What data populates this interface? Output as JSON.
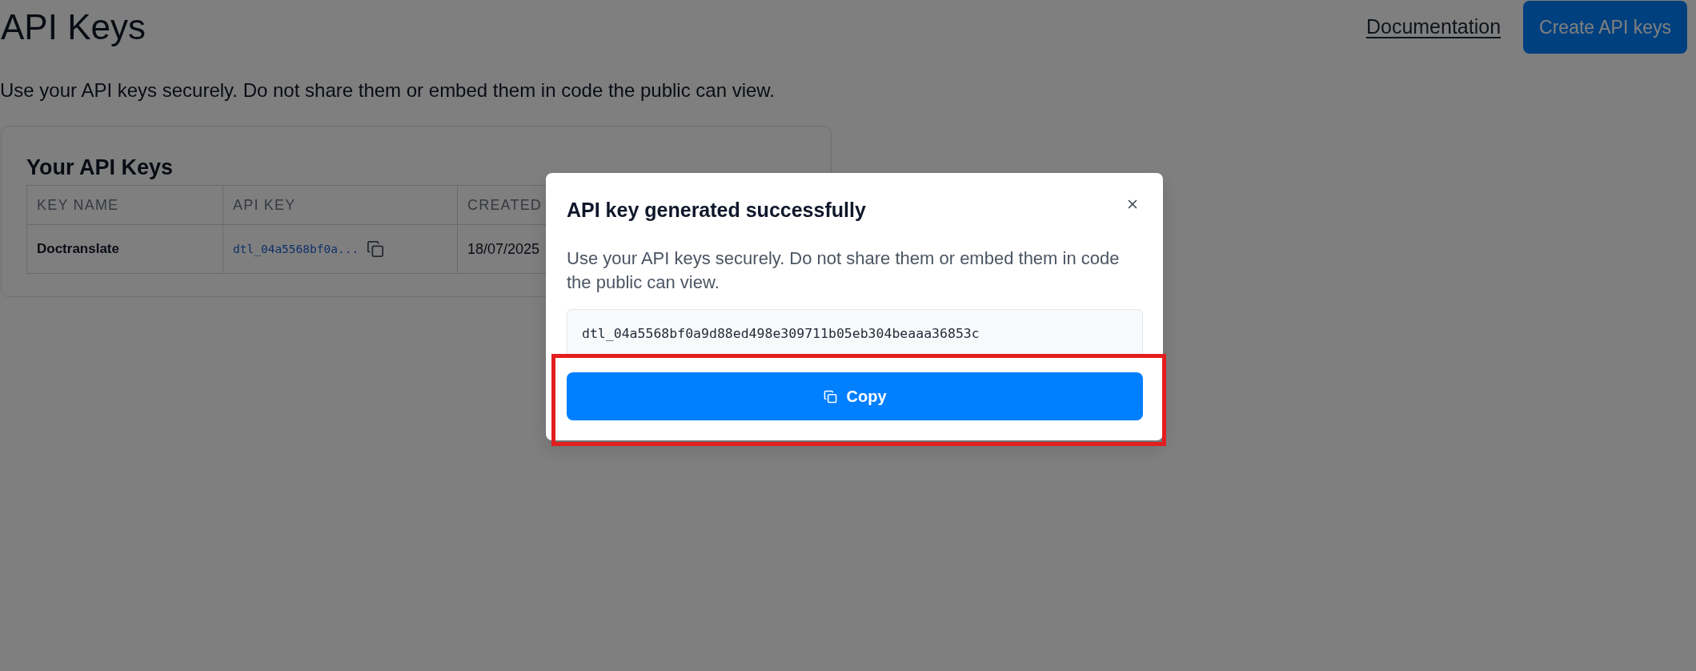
{
  "page": {
    "title": "API Keys",
    "documentation_link": "Documentation",
    "create_button": "Create API keys",
    "description": "Use your API keys securely. Do not share them or embed them in code the public can view."
  },
  "keys_card": {
    "title": "Your API Keys",
    "columns": [
      "KEY NAME",
      "API KEY",
      "CREATED"
    ],
    "rows": [
      {
        "key_name": "Doctranslate",
        "api_key": "dtl_04a5568bf0a...",
        "created": "18/07/2025"
      }
    ]
  },
  "dialog": {
    "title": "API key generated successfully",
    "description": "Use your API keys securely. Do not share them or embed them in code the public can view.",
    "api_key": "dtl_04a5568bf0a9d88ed498e309711b05eb304beaaa36853c",
    "copy_button": "Copy"
  }
}
